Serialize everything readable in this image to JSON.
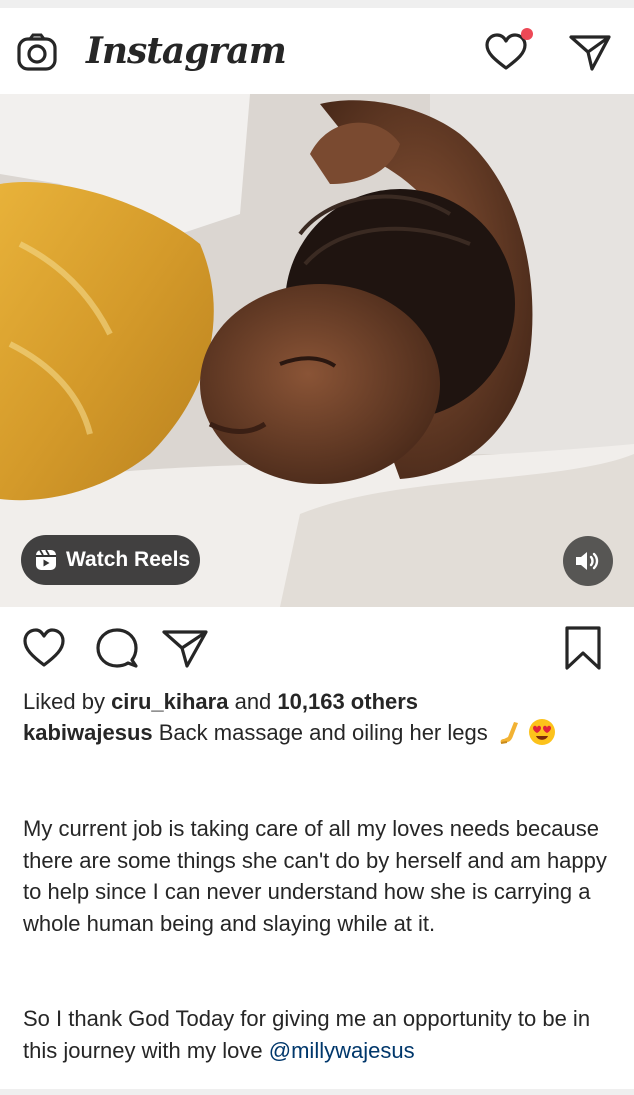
{
  "app": {
    "name": "Instagram"
  },
  "header": {
    "camera_icon": "camera-icon",
    "activity_icon": "heart-icon",
    "direct_icon": "paper-plane-icon",
    "notification_color": "#ed4956"
  },
  "media": {
    "watch_reels_label": "Watch Reels",
    "reels_icon": "reels-icon",
    "volume_icon": "speaker-icon"
  },
  "actions": {
    "like_icon": "heart-icon",
    "comment_icon": "comment-icon",
    "share_icon": "paper-plane-icon",
    "save_icon": "bookmark-icon"
  },
  "post": {
    "likes_prefix": "Liked by ",
    "liked_by_user": "ciru_kihara",
    "likes_mid": " and ",
    "likes_count": "10,163 others",
    "author": "kabiwajesus",
    "caption_text": " Back massage and oiling her legs ",
    "caption_emojis": [
      "leg-emoji",
      "heart-eyes-emoji"
    ],
    "body_paragraph_1": "My current job is taking care of all my loves needs because there are some things she can't do by herself and am happy to help since I can never understand how she is carrying a whole human being and slaying while at it.",
    "body_paragraph_2": "So I thank God Today for giving me an opportunity to be in this journey with my love ",
    "mention": "@millywajesus",
    "mention_color": "#00376b"
  }
}
